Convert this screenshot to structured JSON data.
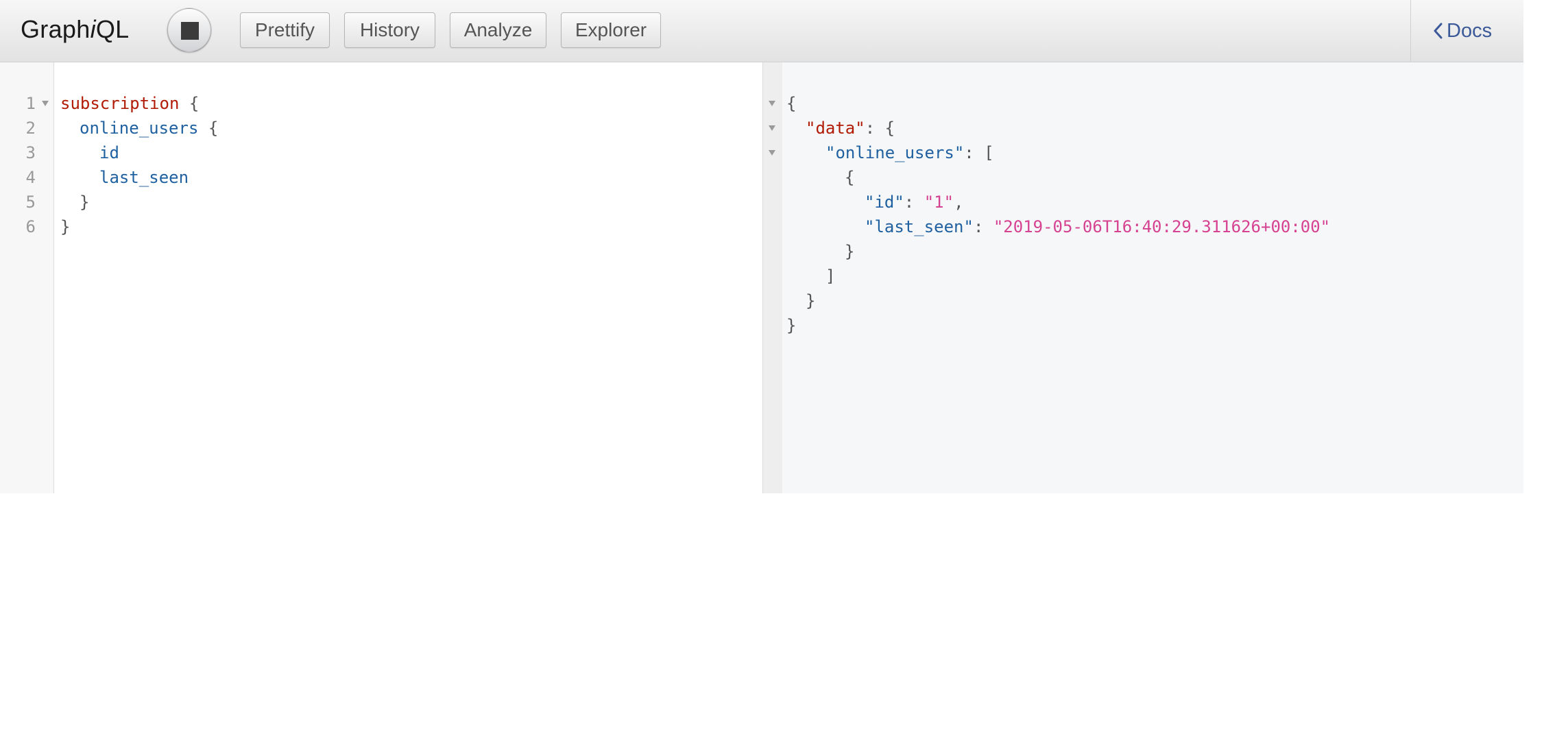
{
  "header": {
    "logo_prefix": "Graph",
    "logo_italic": "i",
    "logo_suffix": "QL",
    "execute_icon": "stop-icon",
    "buttons": {
      "prettify": "Prettify",
      "history": "History",
      "analyze": "Analyze",
      "explorer": "Explorer"
    },
    "docs_label": "Docs",
    "docs_icon": "chevron-left-icon"
  },
  "query_editor": {
    "line_numbers": [
      "1",
      "2",
      "3",
      "4",
      "5",
      "6"
    ],
    "lines": [
      {
        "keyword": "subscription",
        "punct": "{"
      },
      {
        "field": "online_users",
        "punct": "{"
      },
      {
        "field": "id"
      },
      {
        "field": "last_seen"
      },
      {
        "punct": "}"
      },
      {
        "punct": "}"
      }
    ]
  },
  "result_viewer": {
    "open_brace": "{",
    "data_key": "\"data\"",
    "online_users_key": "\"online_users\"",
    "array_open": "[",
    "object_open": "{",
    "id_key": "\"id\"",
    "id_value": "\"1\"",
    "last_seen_key": "\"last_seen\"",
    "last_seen_value": "\"2019-05-06T16:40:29.311626+00:00\"",
    "object_close": "}",
    "array_close": "]",
    "data_close": "}",
    "close_brace": "}",
    "colon": ":",
    "comma": ","
  },
  "colors": {
    "keyword": "#b11a04",
    "field": "#1f61a0",
    "string": "#d64292",
    "docs_link": "#3b5998"
  }
}
